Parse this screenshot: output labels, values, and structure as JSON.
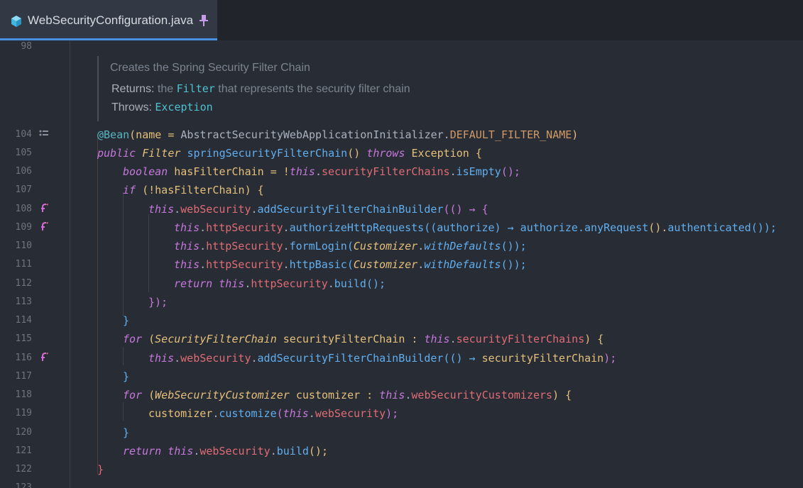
{
  "tab": {
    "filename": "WebSecurityConfiguration.java",
    "icon": "java-class-icon",
    "pinned_icon": "pin-icon"
  },
  "doc": {
    "summary": "Creates the Spring Security Filter Chain",
    "returns_label": "Returns:",
    "returns_pre": "the",
    "returns_code": "Filter",
    "returns_post": "that represents the security filter chain",
    "throws_label": "Throws:",
    "throws_code": "Exception"
  },
  "gutter": {
    "lines": [
      "98",
      "104",
      "105",
      "106",
      "107",
      "108",
      "109",
      "110",
      "111",
      "112",
      "113",
      "114",
      "115",
      "116",
      "117",
      "118",
      "119",
      "120",
      "121",
      "122",
      "123"
    ],
    "icons": {
      "104": "bean-list-icon",
      "108": "lambda-call-icon",
      "109": "lambda-call-icon",
      "116": "lambda-call-icon"
    }
  },
  "code": {
    "l104": [
      "@Bean",
      "(name = ",
      "AbstractSecurityWebApplicationInitializer",
      ".",
      "DEFAULT_FILTER_NAME",
      ")"
    ],
    "l105": [
      "public",
      " ",
      "Filter",
      " ",
      "springSecurityFilterChain",
      "() ",
      "throws",
      " ",
      "Exception",
      " {"
    ],
    "l106": [
      "boolean",
      " hasFilterChain = !",
      "this",
      ".",
      "securityFilterChains",
      ".",
      "isEmpty",
      "();"
    ],
    "l107": [
      "if",
      " (!hasFilterChain) {"
    ],
    "l108": [
      "this",
      ".",
      "webSecurity",
      ".",
      "addSecurityFilterChainBuilder",
      "(() → {"
    ],
    "l109": [
      "this",
      ".",
      "httpSecurity",
      ".",
      "authorizeHttpRequests",
      "((authorize) → authorize.",
      "anyRequest",
      "().",
      "authenticated",
      "());"
    ],
    "l110": [
      "this",
      ".",
      "httpSecurity",
      ".",
      "formLogin",
      "(",
      "Customizer",
      ".",
      "withDefaults",
      "());"
    ],
    "l111": [
      "this",
      ".",
      "httpSecurity",
      ".",
      "httpBasic",
      "(",
      "Customizer",
      ".",
      "withDefaults",
      "());"
    ],
    "l112": [
      "return",
      " ",
      "this",
      ".",
      "httpSecurity",
      ".",
      "build",
      "();"
    ],
    "l113": [
      "});"
    ],
    "l114": [
      "}"
    ],
    "l115": [
      "for",
      " (",
      "SecurityFilterChain",
      " securityFilterChain : ",
      "this",
      ".",
      "securityFilterChains",
      ") {"
    ],
    "l116": [
      "this",
      ".",
      "webSecurity",
      ".",
      "addSecurityFilterChainBuilder",
      "(() → ",
      "securityFilterChain",
      ");"
    ],
    "l117": [
      "}"
    ],
    "l118": [
      "for",
      " (",
      "WebSecurityCustomizer",
      " customizer : ",
      "this",
      ".",
      "webSecurityCustomizers",
      ") {"
    ],
    "l119": [
      "customizer",
      ".",
      "customize",
      "(",
      "this",
      ".",
      "webSecurity",
      ");"
    ],
    "l120": [
      "}"
    ],
    "l121": [
      "return",
      " ",
      "this",
      ".",
      "webSecurity",
      ".",
      "build",
      "();"
    ],
    "l122": [
      "}"
    ]
  },
  "colors": {
    "background": "#282c34",
    "tab_accent": "#4a90e2",
    "keyword": "#c678dd",
    "field": "#e06c75",
    "method": "#61afef",
    "type": "#e5c07b"
  }
}
